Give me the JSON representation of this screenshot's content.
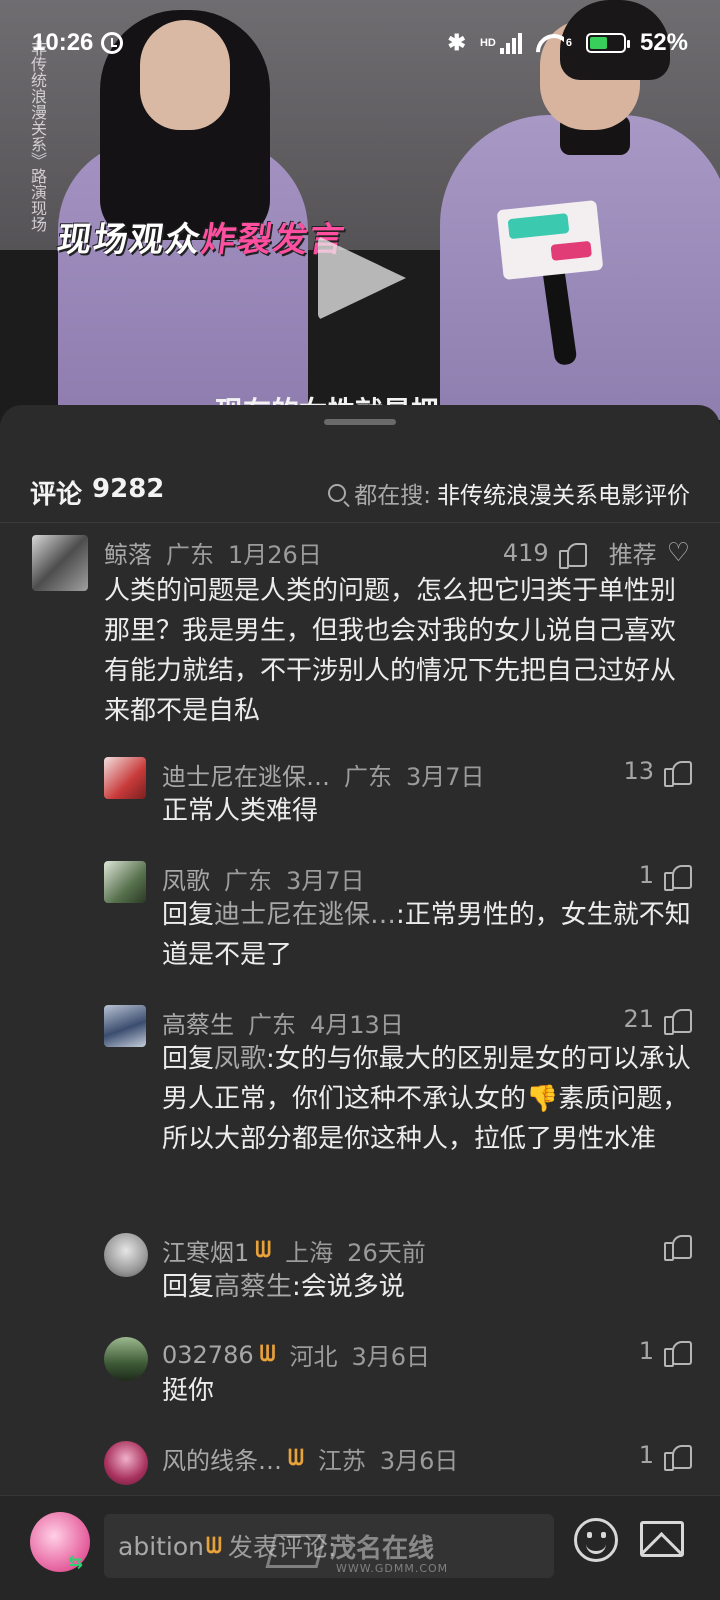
{
  "status_bar": {
    "time": "10:26",
    "network": "HD",
    "wifi_badge": "6",
    "battery": "52%",
    "battery_level": 0.52
  },
  "video": {
    "side_title": "非传统浪漫关系》路演现场",
    "caption_white": "现场观众",
    "caption_pink": "炸裂发言",
    "subtitle_partial": "现在的女性就是把",
    "play_icon": "play-icon"
  },
  "comments_header": {
    "label": "评论",
    "count": "9282",
    "search_label": "都在搜:",
    "search_term": "非传统浪漫关系电影评价"
  },
  "comments": [
    {
      "name": "鲸落",
      "location": "广东",
      "date": "1月26日",
      "likes": "419",
      "recommend": "推荐",
      "text": "人类的问题是人类的问题，怎么把它归类于单性别那里？我是男生，但我也会对我的女儿说自己喜欢有能力就结，不干涉别人的情况下先把自己过好从来都不是自私"
    },
    {
      "name": "迪士尼在逃保…",
      "location": "广东",
      "date": "3月7日",
      "likes": "13",
      "text": "正常人类难得"
    },
    {
      "name": "凤歌",
      "location": "广东",
      "date": "3月7日",
      "likes": "1",
      "reply_prefix": "回复",
      "reply_to": "迪士尼在逃保…",
      "text": ":正常男性的，女生就不知道是不是了"
    },
    {
      "name": "高蔡生",
      "location": "广东",
      "date": "4月13日",
      "likes": "21",
      "reply_prefix": "回复",
      "reply_to": "凤歌",
      "text": ":女的与你最大的区别是女的可以承认男人正常，你们这种不承认女的👎素质问题，所以大部分都是你这种人，拉低了男性水准"
    },
    {
      "name": "江寒烟1",
      "vip": "ᗯ",
      "location": "上海",
      "date": "26天前",
      "likes": "",
      "reply_prefix": "回复",
      "reply_to": "高蔡生",
      "text": ":会说多说"
    },
    {
      "name": "032786",
      "vip": "ᗯ",
      "location": "河北",
      "date": "3月6日",
      "likes": "1",
      "text": "挺你"
    },
    {
      "name": "风的线条…",
      "vip": "ᗯ",
      "location": "江苏",
      "date": "3月6日",
      "likes": "1",
      "text": ""
    }
  ],
  "bottom_bar": {
    "username": "abition",
    "vip": "ᗯ",
    "placeholder": "发表评论:",
    "watermark_main": "茂名在线",
    "watermark_sub": "WWW.GDMM.COM"
  },
  "colors": {
    "background": "#2b2b2b",
    "pink_caption": "#ff4fa0",
    "vip_gold": "#e8a23a",
    "switch_green": "#2fcf72"
  }
}
